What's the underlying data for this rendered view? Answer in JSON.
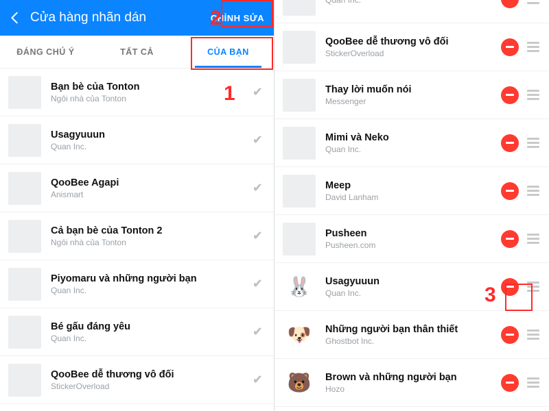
{
  "left": {
    "header": {
      "title": "Cửa hàng nhãn dán",
      "edit_label": "CHỈNH SỬA"
    },
    "tabs": {
      "notable": "ĐÁNG CHÚ Ý",
      "all": "TẤT CẢ",
      "yours": "CỦA BẠN"
    },
    "items": [
      {
        "title": "Bạn bè của Tonton",
        "sub": "Ngôi nhà của Tonton"
      },
      {
        "title": "Usagyuuun",
        "sub": "Quan Inc."
      },
      {
        "title": "QooBee Agapi",
        "sub": "Anismart"
      },
      {
        "title": "Cả bạn bè của Tonton 2",
        "sub": "Ngôi nhà của Tonton"
      },
      {
        "title": "Piyomaru và những người bạn",
        "sub": "Quan Inc."
      },
      {
        "title": "Bé gấu đáng yêu",
        "sub": "Quan Inc."
      },
      {
        "title": "QooBee dễ thương vô đối",
        "sub": "StickerOverload"
      }
    ]
  },
  "right": {
    "items": [
      {
        "title": "",
        "sub": "Quan Inc.",
        "thumb": "placeholder"
      },
      {
        "title": "QooBee dễ thương vô đối",
        "sub": "StickerOverload",
        "thumb": "placeholder"
      },
      {
        "title": "Thay lời muốn nói",
        "sub": "Messenger",
        "thumb": "placeholder"
      },
      {
        "title": "Mimi và Neko",
        "sub": "Quan Inc.",
        "thumb": "placeholder"
      },
      {
        "title": "Meep",
        "sub": "David Lanham",
        "thumb": "placeholder"
      },
      {
        "title": "Pusheen",
        "sub": "Pusheen.com",
        "thumb": "placeholder"
      },
      {
        "title": "Usagyuuun",
        "sub": "Quan Inc.",
        "thumb": "bunny"
      },
      {
        "title": "Những người bạn thân thiết",
        "sub": "Ghostbot Inc.",
        "thumb": "dog"
      },
      {
        "title": "Brown và những người bạn",
        "sub": "Hozo",
        "thumb": "bear"
      }
    ]
  },
  "annotations": {
    "n1": "1",
    "n2": "2",
    "n3": "3"
  }
}
